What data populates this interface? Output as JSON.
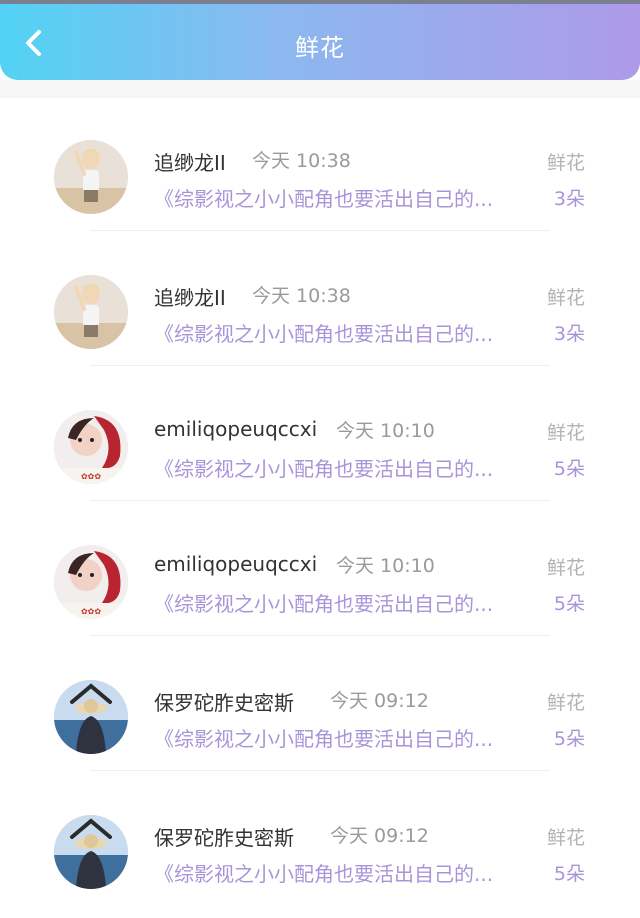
{
  "header": {
    "title": "鲜花"
  },
  "colors": {
    "accent": "#a895d9",
    "gradient_start": "#52d3f5",
    "gradient_end": "#ae9ae8"
  },
  "items": [
    {
      "name": "追缈龙II",
      "time": "今天 10:38",
      "work": "《综影视之小小配角也要活出自己的...",
      "gift": "鲜花",
      "count": "3朵",
      "avatar": "avatar-blonde-child"
    },
    {
      "name": "追缈龙II",
      "time": "今天 10:38",
      "work": "《综影视之小小配角也要活出自己的...",
      "gift": "鲜花",
      "count": "3朵",
      "avatar": "avatar-blonde-child"
    },
    {
      "name": "emiliqopeuqccxi",
      "time": "今天 10:10",
      "work": "《综影视之小小配角也要活出自己的...",
      "gift": "鲜花",
      "count": "5朵",
      "avatar": "avatar-red-hair"
    },
    {
      "name": "emiliqopeuqccxi",
      "time": "今天 10:10",
      "work": "《综影视之小小配角也要活出自己的...",
      "gift": "鲜花",
      "count": "5朵",
      "avatar": "avatar-red-hair"
    },
    {
      "name": "保罗砣胙史密斯",
      "time": "今天 09:12",
      "work": "《综影视之小小配角也要活出自己的...",
      "gift": "鲜花",
      "count": "5朵",
      "avatar": "avatar-sea-hat"
    },
    {
      "name": "保罗砣胙史密斯",
      "time": "今天 09:12",
      "work": "《综影视之小小配角也要活出自己的...",
      "gift": "鲜花",
      "count": "5朵",
      "avatar": "avatar-sea-hat"
    }
  ]
}
